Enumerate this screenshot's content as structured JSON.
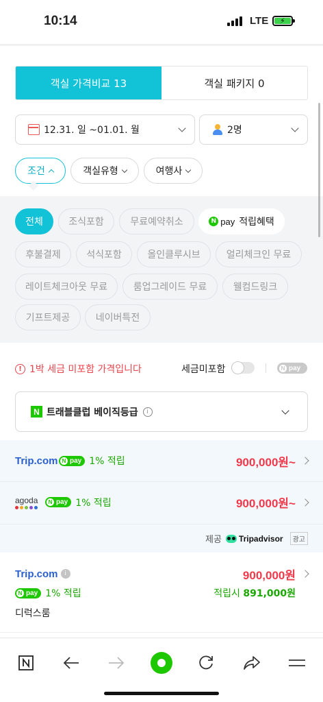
{
  "status_bar": {
    "time": "10:14",
    "network": "LTE"
  },
  "tabs": [
    {
      "label": "객실 가격비교 13",
      "active": true
    },
    {
      "label": "객실 패키지 0",
      "active": false
    }
  ],
  "date_selector": {
    "label": "12.31. 일 ~01.01. 월"
  },
  "guest_selector": {
    "label": "2명"
  },
  "filter_pills": [
    {
      "label": "조건",
      "active": true
    },
    {
      "label": "객실유형",
      "active": false
    },
    {
      "label": "여행사",
      "active": false
    }
  ],
  "condition_chips": [
    {
      "label": "전체",
      "active": true
    },
    {
      "label": "조식포함"
    },
    {
      "label": "무료예약취소"
    },
    {
      "label": "적립혜택",
      "badge": "pay"
    },
    {
      "label": "후불결제"
    },
    {
      "label": "석식포함"
    },
    {
      "label": "올인클루시브"
    },
    {
      "label": "얼리체크인 무료"
    },
    {
      "label": "레이트체크아웃 무료"
    },
    {
      "label": "룸업그레이드 무료"
    },
    {
      "label": "웰컴드링크"
    },
    {
      "label": "기프트제공"
    },
    {
      "label": "네이버특전"
    }
  ],
  "tax": {
    "warning": "1박 세금 미포함 가격입니다",
    "toggle_label": "세금미포함",
    "npay_label": "pay"
  },
  "club": {
    "label": "트래블클럽 베이직등급"
  },
  "offers": [
    {
      "provider": "Trip.com",
      "npay": "pay",
      "earn": "1% 적립",
      "price": "900,000원~"
    },
    {
      "provider": "agoda",
      "npay": "pay",
      "earn": "1% 적립",
      "price": "900,000원~"
    }
  ],
  "provided_by": {
    "label": "제공",
    "brand": "Tripadvisor",
    "ad": "광고"
  },
  "listing": {
    "provider": "Trip.com",
    "price": "900,000원",
    "npay": "pay",
    "earn": "1% 적립",
    "after_label": "적립시",
    "after_price": "891,000원",
    "room": "디럭스룸"
  },
  "colors": {
    "accent": "#12c2d6",
    "price": "#f0394a",
    "npay_green": "#1ec800"
  }
}
